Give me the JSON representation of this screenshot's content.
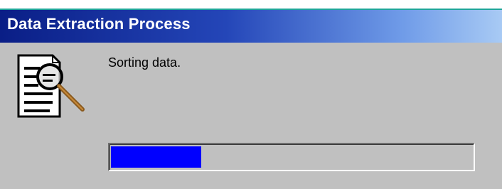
{
  "window": {
    "title": "Data Extraction Process"
  },
  "dialog": {
    "icon": "document-magnifier-icon",
    "status_text": "Sorting data."
  },
  "progress": {
    "fraction": 0.25,
    "fill_color": "#0000ff"
  },
  "colors": {
    "titlebar_start": "#0a1e86",
    "titlebar_end": "#a8caf4",
    "dialog_background": "#c0c0c0",
    "accent_line": "#1fa59a"
  }
}
